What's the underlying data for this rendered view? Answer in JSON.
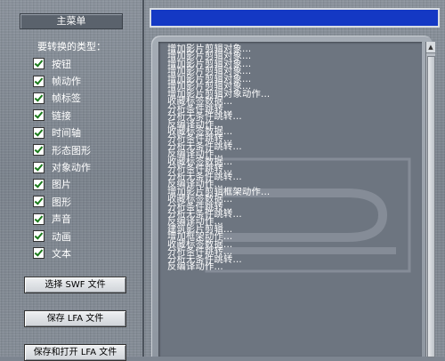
{
  "left": {
    "title": "主菜单",
    "types_label": "要转换的类型：",
    "checkboxes": [
      {
        "label": "按钮",
        "checked": true
      },
      {
        "label": "帧动作",
        "checked": true
      },
      {
        "label": "帧标签",
        "checked": true
      },
      {
        "label": "链接",
        "checked": true
      },
      {
        "label": "时间轴",
        "checked": true
      },
      {
        "label": "形态图形",
        "checked": true
      },
      {
        "label": "对象动作",
        "checked": true
      },
      {
        "label": "图片",
        "checked": true
      },
      {
        "label": "图形",
        "checked": true
      },
      {
        "label": "声音",
        "checked": true
      },
      {
        "label": "动画",
        "checked": true
      },
      {
        "label": "文本",
        "checked": true
      }
    ],
    "buttons": {
      "select_swf": "选择 SWF 文件",
      "save_lfa": "保存 LFA 文件",
      "save_open_lfa": "保存和打开 LFA 文件"
    }
  },
  "progress": {
    "fraction": 1.0
  },
  "log": [
    "增加影片剪辑对象...",
    "增加影片剪辑对象...",
    "增加影片剪辑对象...",
    "增加影片剪辑对象...",
    "增加影片剪辑对象...",
    "增加影片剪辑对象...",
    "增加影片剪辑对象动作...",
    "收藏标签数据...",
    "分析条件跳转...",
    "分析无条件跳转...",
    "反编译动作...",
    "收藏标签数据...",
    "分析条件跳转...",
    "分析无条件跳转...",
    "反编译动作...",
    "收藏标签数据...",
    "分析条件跳转...",
    "分析无条件跳转...",
    "反编译动作...",
    "增加影片剪辑框架动作...",
    "收藏标签数据...",
    "分析条件跳转...",
    "分析无条件跳转...",
    "反编译动作...",
    "建筑影片剪辑...",
    "增加框架动作...",
    "收藏标签数据...",
    "分析条件跳转...",
    "分析无条件跳转...",
    "反编译动作..."
  ]
}
